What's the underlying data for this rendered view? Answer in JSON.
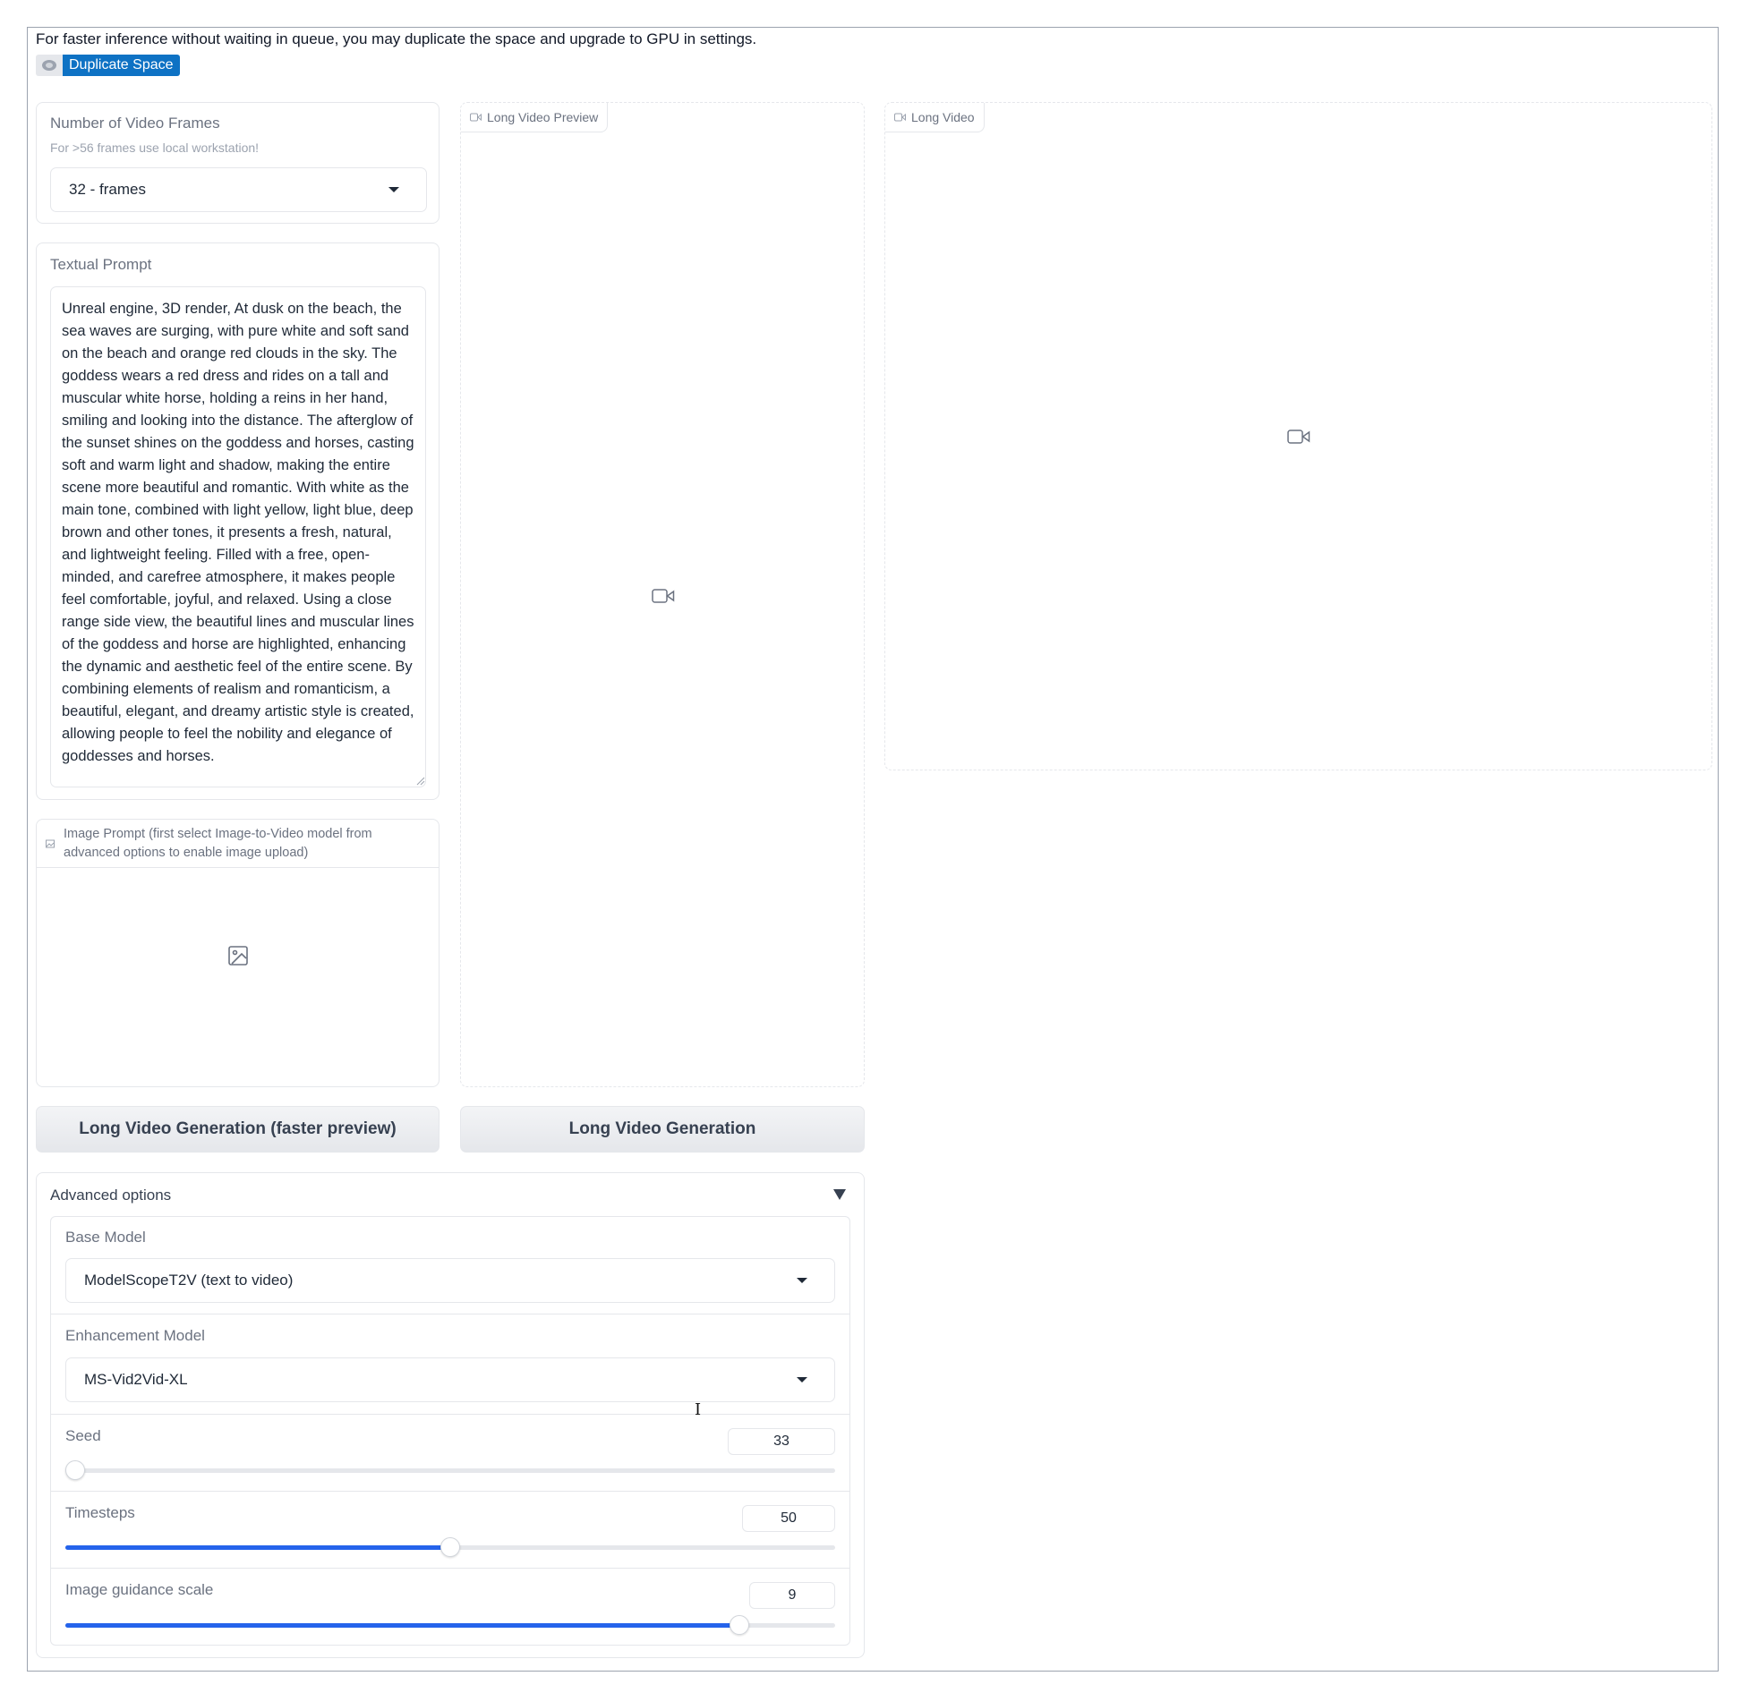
{
  "banner": {
    "notice": "For faster inference without waiting in queue, you may duplicate the space and upgrade to GPU in settings.",
    "duplicate_label": "Duplicate Space"
  },
  "frames": {
    "label": "Number of Video Frames",
    "info": "For >56 frames use local workstation!",
    "value": "32 - frames"
  },
  "prompt": {
    "label": "Textual Prompt",
    "value": "Unreal engine, 3D render, At dusk on the beach, the sea waves are surging, with pure white and soft sand on the beach and orange red clouds in the sky. The goddess wears a red dress and rides on a tall and muscular white horse, holding a reins in her hand, smiling and looking into the distance. The afterglow of the sunset shines on the goddess and horses, casting soft and warm light and shadow, making the entire scene more beautiful and romantic. With white as the main tone, combined with light yellow, light blue, deep brown and other tones, it presents a fresh, natural, and lightweight feeling. Filled with a free, open-minded, and carefree atmosphere, it makes people feel comfortable, joyful, and relaxed. Using a close range side view, the beautiful lines and muscular lines of the goddess and horse are highlighted, enhancing the dynamic and aesthetic feel of the entire scene. By combining elements of realism and romanticism, a beautiful, elegant, and dreamy artistic style is created, allowing people to feel the nobility and elegance of goddesses and horses."
  },
  "image_prompt": {
    "label": "Image Prompt (first select Image-to-Video model from advanced options to enable image upload)"
  },
  "preview_video": {
    "label": "Long Video Preview"
  },
  "long_video": {
    "label": "Long Video"
  },
  "buttons": {
    "preview": "Long Video Generation (faster preview)",
    "generate": "Long Video Generation"
  },
  "advanced": {
    "title": "Advanced options",
    "base_model": {
      "label": "Base Model",
      "value": "ModelScopeT2V (text to video)"
    },
    "enhancement_model": {
      "label": "Enhancement Model",
      "value": "MS-Vid2Vid-XL"
    },
    "seed": {
      "label": "Seed",
      "value": "33",
      "fraction": 0.0
    },
    "timesteps": {
      "label": "Timesteps",
      "value": "50",
      "fraction": 0.5
    },
    "guidance": {
      "label": "Image guidance scale",
      "value": "9",
      "fraction": 0.875
    }
  },
  "colors": {
    "accent": "#2563eb",
    "badge": "#0e72c4"
  }
}
